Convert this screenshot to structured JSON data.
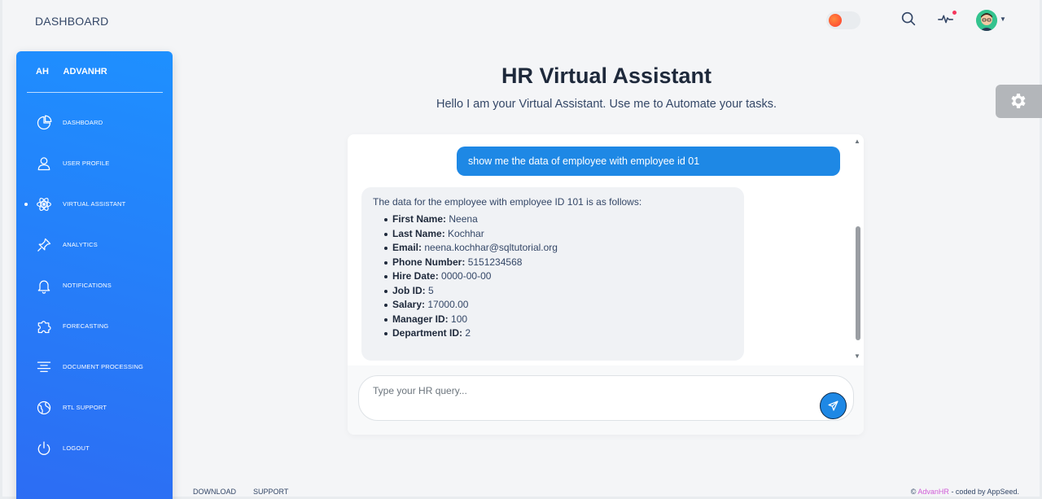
{
  "topbar": {
    "title": "DASHBOARD",
    "icons": [
      "theme-toggle",
      "search-icon",
      "activity-icon",
      "avatar"
    ]
  },
  "sidebar": {
    "brand_mini": "AH",
    "brand_name": "ADVANHR",
    "items": [
      {
        "label": "DASHBOARD",
        "icon": "pie-chart-icon",
        "active": false
      },
      {
        "label": "USER PROFILE",
        "icon": "user-icon",
        "active": false
      },
      {
        "label": "VIRTUAL ASSISTANT",
        "icon": "atom-icon",
        "active": true
      },
      {
        "label": "ANALYTICS",
        "icon": "pin-icon",
        "active": false
      },
      {
        "label": "NOTIFICATIONS",
        "icon": "bell-icon",
        "active": false
      },
      {
        "label": "FORECASTING",
        "icon": "puzzle-icon",
        "active": false
      },
      {
        "label": "DOCUMENT PROCESSING",
        "icon": "align-center-icon",
        "active": false
      },
      {
        "label": "RTL SUPPORT",
        "icon": "globe-icon",
        "active": false
      },
      {
        "label": "LOGOUT",
        "icon": "power-icon",
        "active": false
      }
    ]
  },
  "main": {
    "title": "HR Virtual Assistant",
    "subtitle": "Hello I am your Virtual Assistant. Use me to Automate your tasks."
  },
  "chat": {
    "user_message": "show me the data of employee with employee id 01",
    "bot_intro": "The data for the employee with employee ID 101 is as follows:",
    "bot_fields": [
      {
        "label": "First Name:",
        "value": "Neena"
      },
      {
        "label": "Last Name:",
        "value": "Kochhar"
      },
      {
        "label": "Email:",
        "value": "neena.kochhar@sqltutorial.org"
      },
      {
        "label": "Phone Number:",
        "value": "5151234568"
      },
      {
        "label": "Hire Date:",
        "value": "0000-00-00"
      },
      {
        "label": "Job ID:",
        "value": "5"
      },
      {
        "label": "Salary:",
        "value": "17000.00"
      },
      {
        "label": "Manager ID:",
        "value": "100"
      },
      {
        "label": "Department ID:",
        "value": "2"
      }
    ],
    "input_placeholder": "Type your HR query...",
    "input_value": ""
  },
  "footer": {
    "links": [
      "DOWNLOAD",
      "SUPPORT"
    ],
    "copyright_symbol": "©",
    "brand": "AdvanHR",
    "credit": " - coded by AppSeed."
  },
  "colors": {
    "sidebar_gradient_start": "#1e90ff",
    "sidebar_gradient_end": "#2d6cf3",
    "user_bubble": "#1e88e5",
    "bot_bubble": "#f0f2f5",
    "footer_brand": "#d05bd7"
  }
}
